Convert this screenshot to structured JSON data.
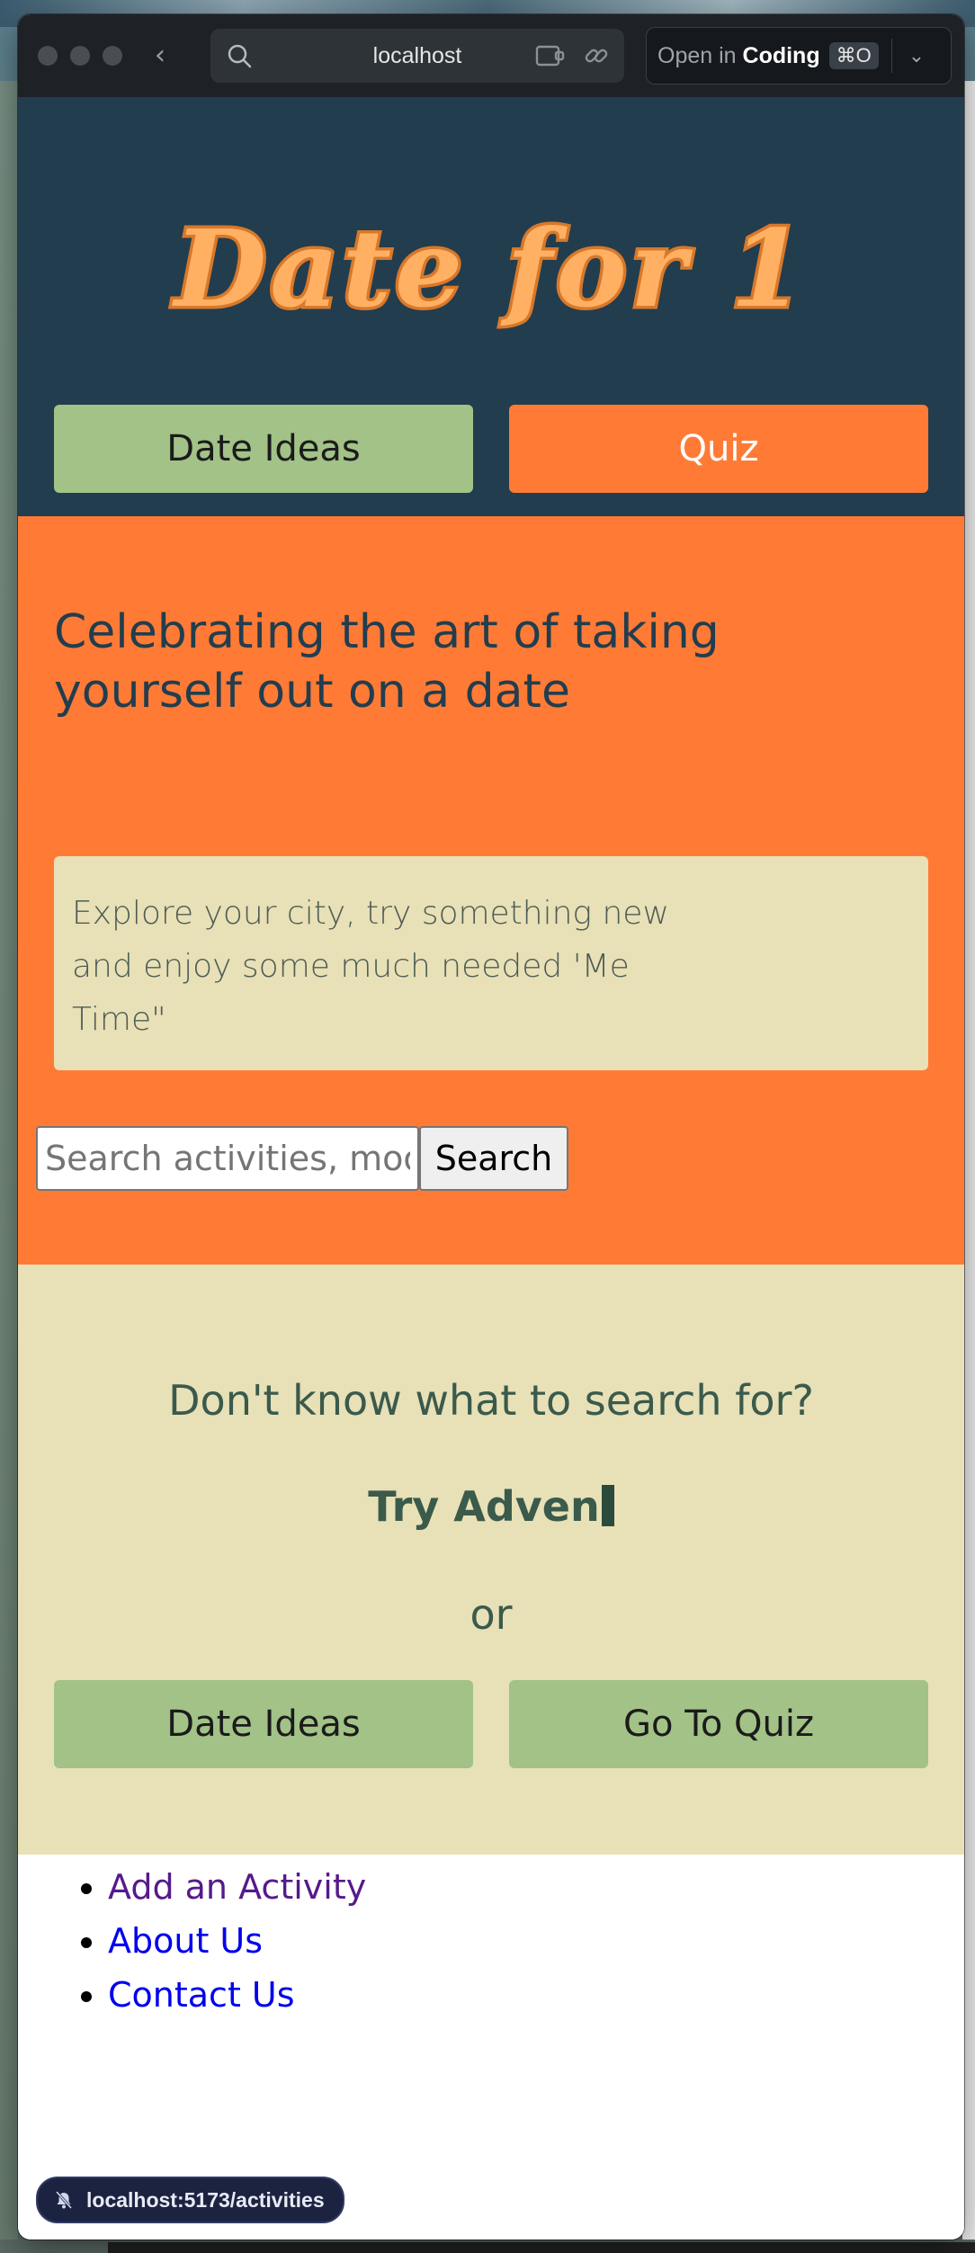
{
  "browser": {
    "url": "localhost",
    "open_in_label": "Open in",
    "open_in_app": "Coding",
    "open_in_shortcut": "⌘O",
    "status_url": "localhost:5173/activities"
  },
  "header": {
    "logo_text": "Date for 1",
    "nav": {
      "date_ideas_label": "Date Ideas",
      "quiz_label": "Quiz"
    }
  },
  "hero": {
    "title": "Celebrating the art of taking yourself out on a date",
    "tagline": "Explore your city, try something new and enjoy some much needed 'Me Time\"",
    "search_placeholder": "Search activities, mood",
    "search_button": "Search"
  },
  "prompt": {
    "question": "Don't know what to search for?",
    "typing_text": "Try Adven",
    "or_text": "or",
    "date_ideas_label": "Date Ideas",
    "quiz_label": "Go To Quiz"
  },
  "footer": {
    "links": [
      "Add an Activity",
      "About Us",
      "Contact Us"
    ]
  },
  "colors": {
    "header_bg": "#223d4e",
    "accent_orange": "#ff7b35",
    "sage_green": "#a2c287",
    "cream": "#e8e0b6",
    "logo_fill": "#ffb062",
    "logo_outline": "#d8782a"
  }
}
